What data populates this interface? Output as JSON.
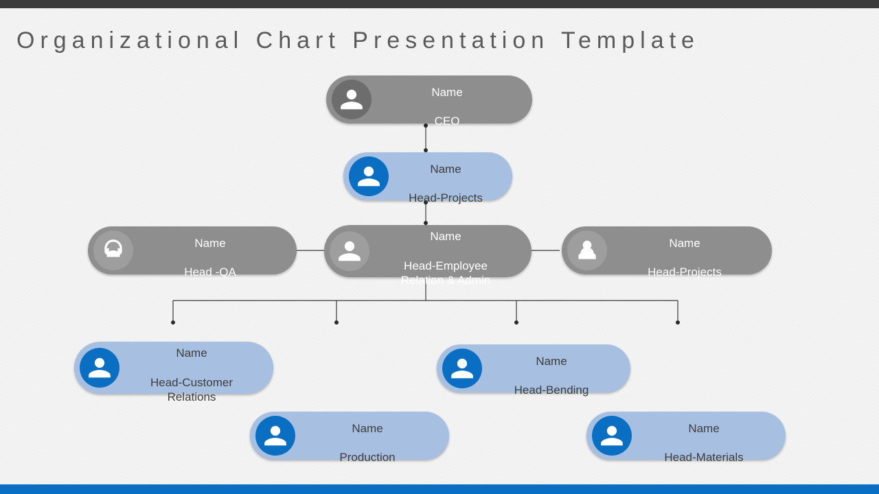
{
  "title": "Organizational Chart Presentation Template",
  "nodes": {
    "ceo": {
      "name": "Name",
      "role": "CEO"
    },
    "projects1": {
      "name": "Name",
      "role": "Head-Projects"
    },
    "qa": {
      "name": "Name",
      "role": "Head -QA"
    },
    "admin": {
      "name": "Name",
      "role": "Head-Employee\nRelation & Admin"
    },
    "projects2": {
      "name": "Name",
      "role": "Head-Projects"
    },
    "customer": {
      "name": "Name",
      "role": "Head-Customer\nRelations"
    },
    "bending": {
      "name": "Name",
      "role": "Head-Bending"
    },
    "production": {
      "name": "Name",
      "role": "Production"
    },
    "materials": {
      "name": "Name",
      "role": "Head-Materials"
    }
  },
  "chart_data": {
    "type": "org-chart",
    "title": "Organizational Chart Presentation Template",
    "root": "ceo",
    "people": [
      {
        "id": "ceo",
        "name": "Name",
        "role": "CEO",
        "color": "gray"
      },
      {
        "id": "projects1",
        "name": "Name",
        "role": "Head-Projects",
        "color": "blue"
      },
      {
        "id": "qa",
        "name": "Name",
        "role": "Head -QA",
        "color": "gray"
      },
      {
        "id": "admin",
        "name": "Name",
        "role": "Head-Employee Relation & Admin",
        "color": "gray"
      },
      {
        "id": "projects2",
        "name": "Name",
        "role": "Head-Projects",
        "color": "gray"
      },
      {
        "id": "customer",
        "name": "Name",
        "role": "Head-Customer Relations",
        "color": "blue"
      },
      {
        "id": "bending",
        "name": "Name",
        "role": "Head-Bending",
        "color": "blue"
      },
      {
        "id": "production",
        "name": "Name",
        "role": "Production",
        "color": "blue"
      },
      {
        "id": "materials",
        "name": "Name",
        "role": "Head-Materials",
        "color": "blue"
      }
    ],
    "edges": [
      [
        "ceo",
        "projects1"
      ],
      [
        "projects1",
        "admin"
      ],
      [
        "admin",
        "qa"
      ],
      [
        "admin",
        "projects2"
      ],
      [
        "admin",
        "customer"
      ],
      [
        "admin",
        "production"
      ],
      [
        "admin",
        "bending"
      ],
      [
        "admin",
        "materials"
      ]
    ],
    "colors": {
      "gray": "#8e8e8e",
      "blue": "#a7bfe0",
      "accent": "#0a6fc2"
    }
  }
}
